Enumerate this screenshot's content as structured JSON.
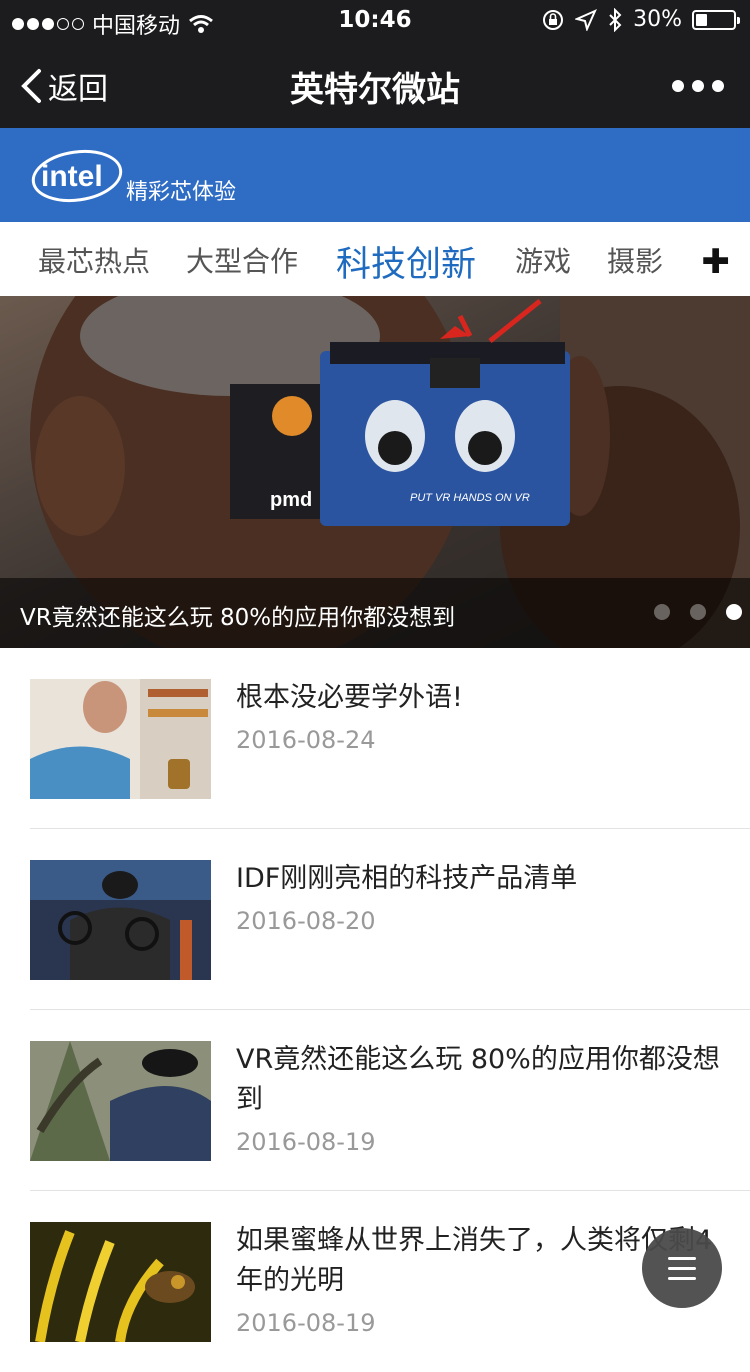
{
  "status_bar": {
    "carrier": "中国移动",
    "time": "10:46",
    "battery": "30%",
    "battery_level": 0.3
  },
  "nav": {
    "back_label": "返回",
    "title": "英特尔微站",
    "more_icon": "more-dots-icon"
  },
  "brand": {
    "logo_text": "intel",
    "slogan": "精彩芯体验",
    "background": "#2f6dc5"
  },
  "tabs": [
    {
      "label": "最芯热点"
    },
    {
      "label": "大型合作"
    },
    {
      "label": "科技创新",
      "active": true
    },
    {
      "label": "游戏"
    },
    {
      "label": "摄影"
    }
  ],
  "tab_accent": "#1f6bbf",
  "hero": {
    "caption": "VR竟然还能这么玩 80%的应用你都没想到",
    "slide_count": 3,
    "active_slide": 3,
    "cardboard_label": "pmd",
    "cardboard_slogan": "PUT VR HANDS ON VR"
  },
  "articles": [
    {
      "title": "根本没必要学外语!",
      "date": "2016-08-24"
    },
    {
      "title": "IDF刚刚亮相的科技产品清单",
      "date": "2016-08-20"
    },
    {
      "title": "VR竟然还能这么玩 80%的应用你都没想到",
      "date": "2016-08-19"
    },
    {
      "title": "如果蜜蜂从世界上消失了，人类将仅剩4年的光明",
      "date": "2016-08-19"
    }
  ],
  "fab_icon": "menu-icon"
}
